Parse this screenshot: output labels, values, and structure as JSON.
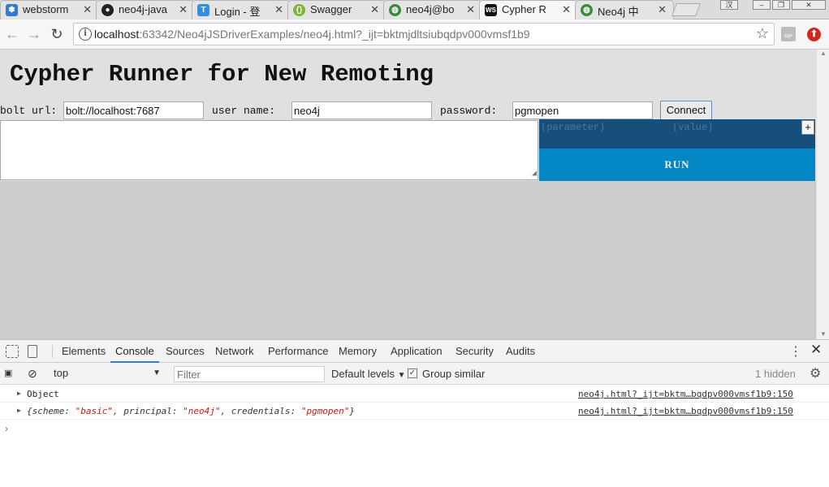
{
  "browser": {
    "tabs": [
      {
        "label": "webstorm",
        "icon": "paw-icon",
        "color": "#2d7cd6",
        "active": false
      },
      {
        "label": "neo4j-java",
        "icon": "github-icon",
        "color": "#222222",
        "active": false
      },
      {
        "label": "Login - 登",
        "icon": "t-icon",
        "color": "#2f8fe8",
        "active": false
      },
      {
        "label": "Swagger",
        "icon": "swagger-icon",
        "color": "#78b829",
        "active": false
      },
      {
        "label": "neo4j@bo",
        "icon": "globe-icon",
        "color": "#3a8a3a",
        "active": false
      },
      {
        "label": "Cypher R",
        "icon": "ws-icon",
        "color": "#111111",
        "active": true
      },
      {
        "label": "Neo4j 中",
        "icon": "globe-icon",
        "color": "#3a8a3a",
        "active": false
      }
    ],
    "tab_close": "✕",
    "window_controls": [
      "汉",
      "–",
      "❐",
      "✕"
    ],
    "url_host": "localhost",
    "url_rest": ":63342/Neo4jJSDriverExamples/neo4j.html?_ijt=bktmjdltsiubqdpv000vmsf1b9",
    "ext_badge": "RP"
  },
  "page": {
    "title": "Cypher Runner for New Remoting",
    "bolt_label": "bolt url:",
    "bolt_value": "bolt://localhost:7687",
    "user_label": "user name:",
    "user_value": "neo4j",
    "password_label": "password:",
    "password_value": "pgmopen",
    "connect_label": "Connect",
    "param_name_placeholder": "(parameter)",
    "param_value_placeholder": "(value)",
    "add_param_label": "+",
    "run_label": "RUN"
  },
  "devtools": {
    "tabs": [
      "Elements",
      "Console",
      "Sources",
      "Network",
      "Performance",
      "Memory",
      "Application",
      "Security",
      "Audits"
    ],
    "active_tab": "Console",
    "context": "top",
    "filter_placeholder": "Filter",
    "levels": "Default levels",
    "group_similar": "Group similar",
    "hidden_count": "1 hidden",
    "console": [
      {
        "message": "Object",
        "source": "neo4j.html?_ijt=bktm…bqdpv000vmsf1b9:150"
      },
      {
        "message_parts": [
          "{",
          "scheme",
          ": ",
          "\"basic\"",
          ", ",
          "principal",
          ": ",
          "\"neo4j\"",
          ", ",
          "credentials",
          ": ",
          "\"pgmopen\"",
          "}"
        ],
        "source": "neo4j.html?_ijt=bktm…bqdpv000vmsf1b9:150"
      }
    ],
    "prompt": "›"
  },
  "colors": {
    "param_panel": "#174f7c",
    "run_button": "#0387c4",
    "page_bg": "#e0e0e0",
    "active_tab_underline": "#3879d9"
  }
}
